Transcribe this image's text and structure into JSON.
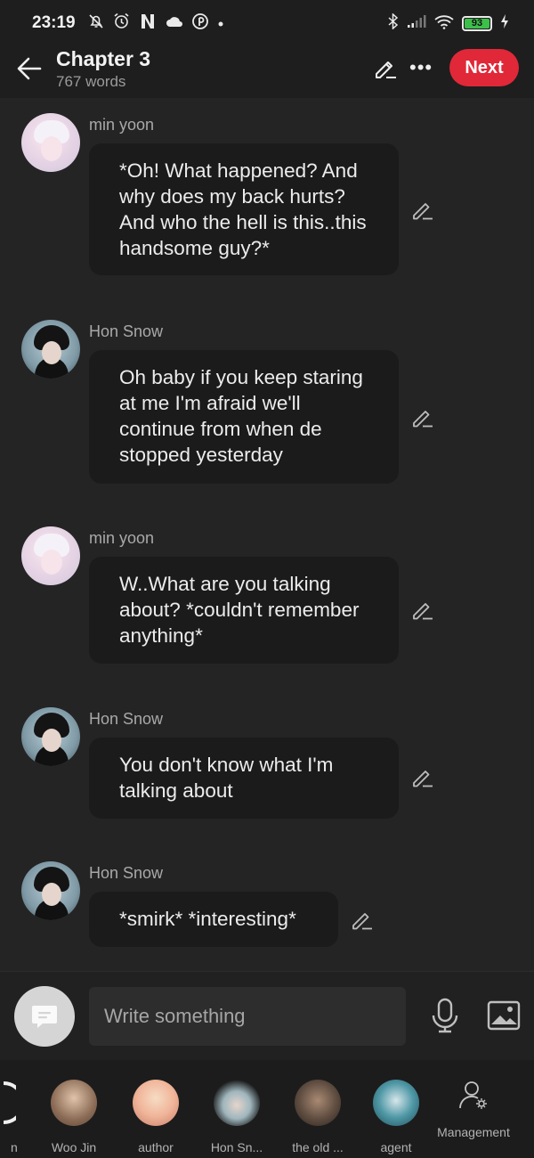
{
  "status_bar": {
    "time": "23:19",
    "battery": "93",
    "icons_left": [
      "mute-icon",
      "alarm-icon",
      "netflix-icon",
      "cloud-icon",
      "pinterest-icon",
      "dot-icon"
    ],
    "icons_right": [
      "bluetooth-icon",
      "signal-icon",
      "wifi-icon",
      "battery-icon",
      "charging-icon"
    ]
  },
  "header": {
    "title": "Chapter 3",
    "subtitle": "767 words",
    "next_label": "Next",
    "more_label": "•••"
  },
  "messages": [
    {
      "sender": "min yoon",
      "text": "*Oh! What happened? And why does my back hurts? And who the hell is this..this handsome guy?*"
    },
    {
      "sender": "Hon Snow",
      "text": "Oh baby if you keep staring at me I'm afraid we'll continue from when de stopped yesterday"
    },
    {
      "sender": "min yoon",
      "text": "W..What are you talking about? *couldn't remember anything*"
    },
    {
      "sender": "Hon Snow",
      "text": "You don't know what I'm talking about"
    },
    {
      "sender": "Hon Snow",
      "text": "*smirk* *interesting*"
    }
  ],
  "input": {
    "placeholder": "Write something"
  },
  "characters": {
    "partial_label": "n",
    "items": [
      {
        "name": "Woo Jin"
      },
      {
        "name": "author"
      },
      {
        "name": "Hon Sn..."
      },
      {
        "name": "the old ..."
      },
      {
        "name": "agent"
      }
    ],
    "management_label": "Management"
  },
  "colors": {
    "accent": "#e02838",
    "background": "#242424",
    "bubble": "#1b1b1b",
    "battery_fill": "#3cc04a"
  }
}
